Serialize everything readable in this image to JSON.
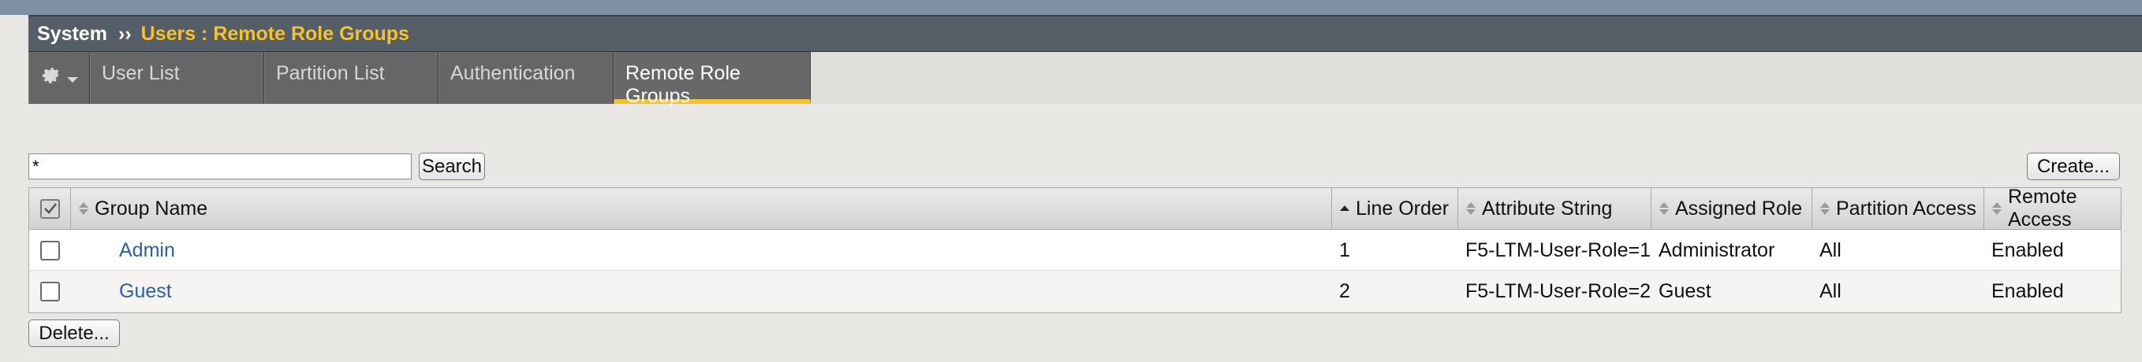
{
  "header": {
    "section": "System",
    "separator": "››",
    "breadcrumb": "Users : Remote Role Groups"
  },
  "tabs": [
    {
      "label": "User List",
      "active": false
    },
    {
      "label": "Partition List",
      "active": false
    },
    {
      "label": "Authentication",
      "active": false
    },
    {
      "label": "Remote Role Groups",
      "active": true
    }
  ],
  "search": {
    "value": "*",
    "button_label": "Search"
  },
  "create_label": "Create...",
  "delete_label": "Delete...",
  "table": {
    "columns": [
      "Group Name",
      "Line Order",
      "Attribute String",
      "Assigned Role",
      "Partition Access",
      "Remote Access"
    ],
    "rows": [
      {
        "group_name": "Admin",
        "line_order": "1",
        "attribute_string": "F5-LTM-User-Role=1",
        "assigned_role": "Administrator",
        "partition_access": "All",
        "remote_access": "Enabled"
      },
      {
        "group_name": "Guest",
        "line_order": "2",
        "attribute_string": "F5-LTM-User-Role=2",
        "assigned_role": "Guest",
        "partition_access": "All",
        "remote_access": "Enabled"
      }
    ]
  },
  "icons": {
    "settings": "gear-icon",
    "menu": "chevron-down-icon",
    "sort": "sort-icon"
  },
  "colors": {
    "accent": "#f3c230",
    "link": "#2b5fa8",
    "titlebar": "#555d67",
    "tab": "#666666"
  }
}
